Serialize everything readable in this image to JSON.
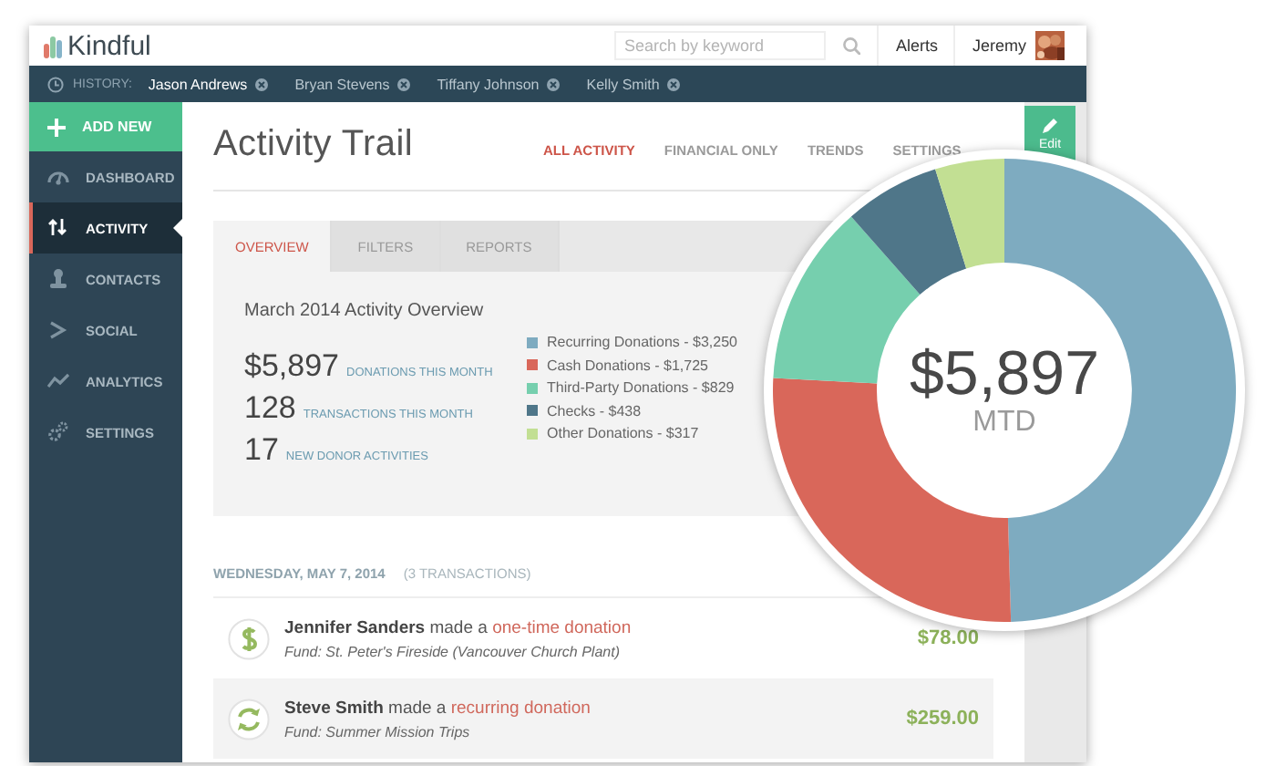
{
  "app": {
    "brand": "Kindful",
    "search": {
      "placeholder": "Search by keyword"
    },
    "alerts": "Alerts",
    "user": "Jeremy"
  },
  "history": {
    "label": "HISTORY:",
    "items": [
      {
        "name": "Jason Andrews",
        "selected": true
      },
      {
        "name": "Bryan Stevens",
        "selected": false
      },
      {
        "name": "Tiffany Johnson",
        "selected": false
      },
      {
        "name": "Kelly Smith",
        "selected": false
      }
    ]
  },
  "sidebar": {
    "add_new": "ADD NEW",
    "items": [
      {
        "label": "DASHBOARD",
        "selected": false
      },
      {
        "label": "ACTIVITY",
        "selected": true
      },
      {
        "label": "CONTACTS",
        "selected": false
      },
      {
        "label": "SOCIAL",
        "selected": false
      },
      {
        "label": "ANALYTICS",
        "selected": false
      },
      {
        "label": "SETTINGS",
        "selected": false
      }
    ]
  },
  "page": {
    "title": "Activity Trail",
    "views": [
      {
        "label": "ALL ACTIVITY",
        "selected": true
      },
      {
        "label": "FINANCIAL ONLY",
        "selected": false
      },
      {
        "label": "TRENDS",
        "selected": false
      },
      {
        "label": "SETTINGS",
        "selected": false
      }
    ],
    "edit": "Edit"
  },
  "panel": {
    "tabs": [
      {
        "label": "OVERVIEW",
        "selected": true
      },
      {
        "label": "FILTERS",
        "selected": false
      },
      {
        "label": "REPORTS",
        "selected": false
      }
    ],
    "heading": "March 2014 Activity Overview",
    "stats": [
      {
        "value": "$5,897",
        "label": "DONATIONS THIS MONTH"
      },
      {
        "value": "128",
        "label": "TRANSACTIONS THIS MONTH"
      },
      {
        "value": "17",
        "label": "NEW DONOR ACTIVITIES"
      }
    ],
    "legend": [
      {
        "label": "Recurring Donations - $3,250",
        "color": "#7eabc0"
      },
      {
        "label": "Cash Donations - $1,725",
        "color": "#d9675a"
      },
      {
        "label": "Third-Party Donations - $829",
        "color": "#76cfae"
      },
      {
        "label": "Checks - $438",
        "color": "#4f7689"
      },
      {
        "label": "Other Donations - $317",
        "color": "#c2df93"
      }
    ]
  },
  "donut": {
    "total": "$5,897",
    "caption": "MTD",
    "chart_data": {
      "type": "donut",
      "values": [
        49.55,
        26.3,
        12.64,
        6.68,
        4.83
      ]
    }
  },
  "day": {
    "date": "WEDNESDAY, MAY 7, 2014",
    "count": "(3 TRANSACTIONS)",
    "transactions": [
      {
        "kind": "one-time",
        "donor": "Jennifer Sanders",
        "action": "made a",
        "donation_type": "one-time donation",
        "fund": "Fund: St. Peter's Fireside (Vancouver Church Plant)",
        "amount": "$78.00",
        "selected": false
      },
      {
        "kind": "recurring",
        "donor": "Steve Smith",
        "action": "made a",
        "donation_type": "recurring donation",
        "fund": "Fund: Summer Mission Trips",
        "amount": "$259.00",
        "selected": true
      }
    ]
  }
}
